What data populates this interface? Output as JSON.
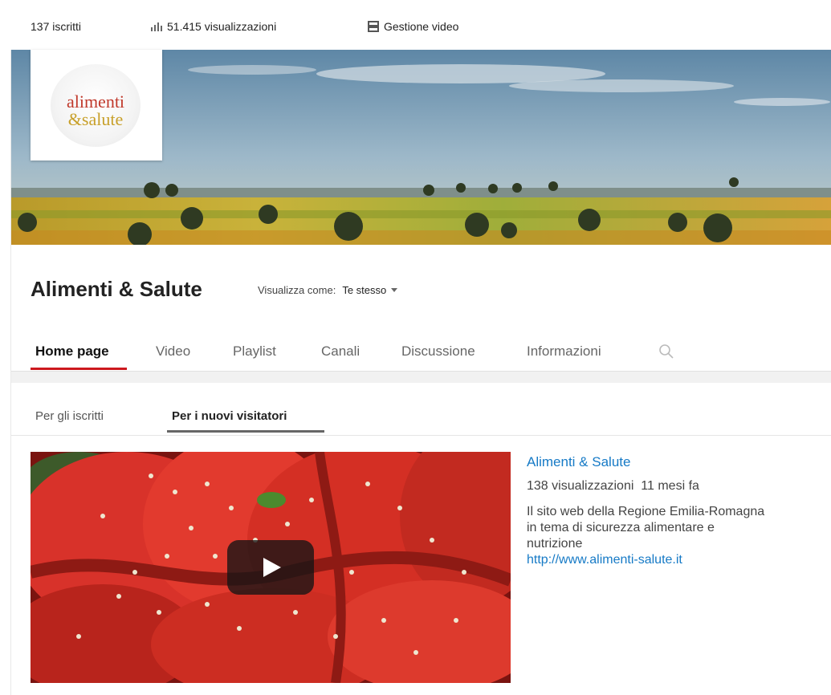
{
  "stats": {
    "subscribers": "137 iscritti",
    "views": "51.415 visualizzazioni",
    "manage_videos": "Gestione video"
  },
  "logo": {
    "line1": "alimenti",
    "line2": "&salute"
  },
  "channel": {
    "title": "Alimenti & Salute",
    "view_as_label": "Visualizza come:",
    "view_as_value": "Te stesso"
  },
  "tabs": [
    "Home page",
    "Video",
    "Playlist",
    "Canali",
    "Discussione",
    "Informazioni"
  ],
  "subtabs": [
    "Per gli iscritti",
    "Per i nuovi visitatori"
  ],
  "video": {
    "title": "Alimenti & Salute",
    "views": "138 visualizzazioni",
    "age": "11 mesi fa",
    "description": "Il sito web della Regione Emilia-Romagna in tema di sicurezza alimentare e nutrizione",
    "link": "http://www.alimenti-salute.it"
  },
  "colors": {
    "accent_red": "#cc181e",
    "link_blue": "#167ac6"
  },
  "icons": [
    "bar-chart-icon",
    "video-manager-icon",
    "search-icon",
    "dropdown-caret-icon",
    "play-icon"
  ]
}
